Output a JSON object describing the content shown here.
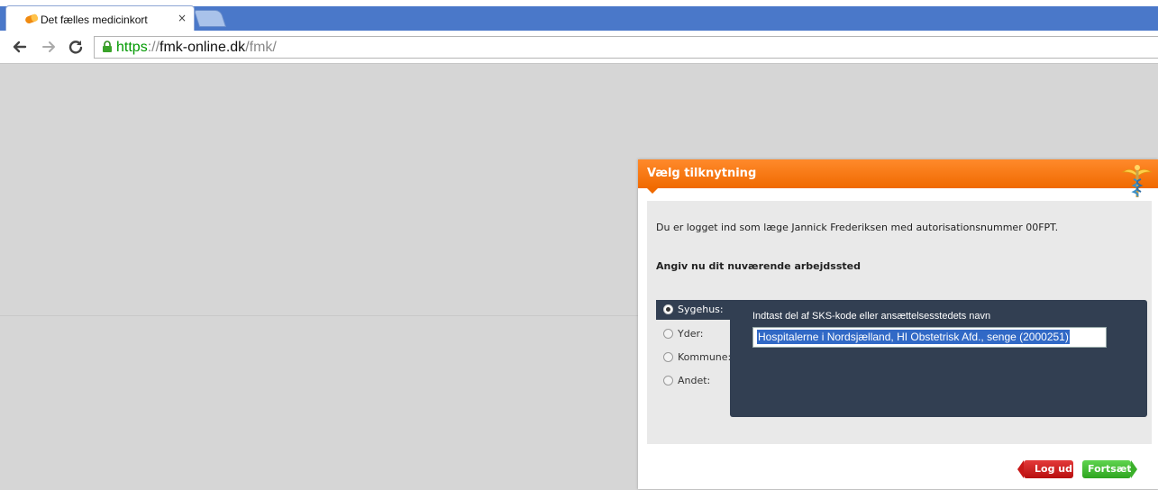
{
  "browser": {
    "tab_title": "Det fælles medicinkort",
    "tab_close": "×",
    "url": {
      "scheme": "https",
      "separator": "://",
      "host": "fmk-online.dk",
      "path": "/fmk/"
    },
    "icons": {
      "back": "arrow-left-icon",
      "forward": "arrow-right-icon",
      "reload": "reload-icon",
      "lock": "lock-icon",
      "favicon": "pill-icon"
    }
  },
  "dialog": {
    "title": "Vælg tilknytning",
    "intro": "Du er logget ind som læge Jannick Frederiksen med autorisationsnummer 00FPT.",
    "heading": "Angiv nu dit nuværende arbejdssted",
    "options": [
      {
        "label": "Sygehus:",
        "selected": true
      },
      {
        "label": "Yder:",
        "selected": false
      },
      {
        "label": "Kommune:",
        "selected": false
      },
      {
        "label": "Andet:",
        "selected": false
      }
    ],
    "panel_label": "Indtast del af SKS-kode eller ansættelsesstedets navn",
    "input_value": "Hospitalerne i Nordsjælland, HI Obstetrisk Afd., senge (2000251)",
    "logout_label": "Log ud",
    "continue_label": "Fortsæt",
    "colors": {
      "header": "#f06a00",
      "panel": "#323f52",
      "logout": "#c81818",
      "continue": "#3bb02b"
    }
  }
}
